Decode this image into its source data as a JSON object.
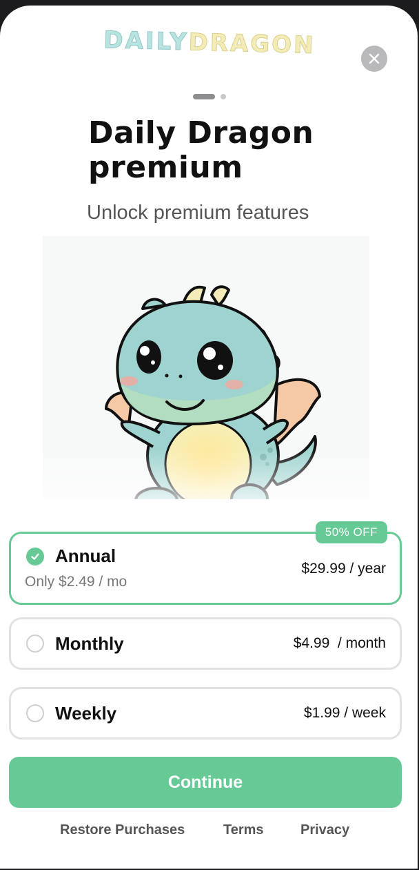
{
  "logo": {
    "part1": "DAILY",
    "part2": "DRAGON"
  },
  "header": {
    "close_icon": "close-icon"
  },
  "pager": {
    "count": 2,
    "active_index": 0
  },
  "title": {
    "line1": "Daily Dragon",
    "line2": "premium"
  },
  "subtitle": "Unlock premium features",
  "hero": {
    "image": "cute-baby-dragon-illustration"
  },
  "plans": [
    {
      "name": "Annual",
      "sub": "Only $2.49 / mo",
      "price": "$29.99 / year",
      "badge": "50% OFF",
      "selected": true
    },
    {
      "name": "Monthly",
      "price": "$4.99  / month",
      "selected": false
    },
    {
      "name": "Weekly",
      "price": "$1.99 / week",
      "selected": false
    }
  ],
  "cta": {
    "continue_label": "Continue"
  },
  "footer": {
    "restore": "Restore Purchases",
    "terms": "Terms",
    "privacy": "Privacy"
  },
  "colors": {
    "accent": "#66c996",
    "background": "#ffffff",
    "border": "#e2e2e4"
  }
}
